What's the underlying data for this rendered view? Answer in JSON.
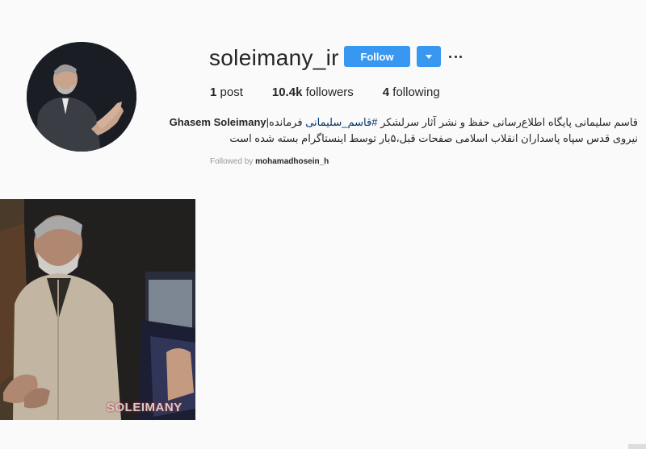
{
  "profile": {
    "username": "soleimany_ir",
    "follow_label": "Follow",
    "dropdown_icon": "chevron-down-icon",
    "more_icon": "more-options-icon"
  },
  "stats": {
    "posts_count": "1",
    "posts_label": " post",
    "followers_count": "10.4k",
    "followers_label": " followers",
    "following_count": "4",
    "following_label": " following"
  },
  "bio": {
    "line1_text": "قاسم سلیمانی پایگاه اطلاع‌رسانی حفظ و نشر آثار سرلشکر",
    "hashtag": "#قاسم_سلیمانی",
    "line1_suffix": "فرمانده|",
    "name": "Ghasem Soleimany",
    "line2": "نیروی قدس سپاه پاسداران انقلاب اسلامی  صفحات قبل،۵بار توسط اینستاگرام بسته شده است"
  },
  "followed_by": {
    "prefix": "Followed by ",
    "user": "mohamadhosein_h"
  },
  "post": {
    "overlay_text": "SOLEIMANY"
  },
  "colors": {
    "accent": "#3897f0",
    "hashtag": "#003569",
    "background": "#fafafa"
  }
}
